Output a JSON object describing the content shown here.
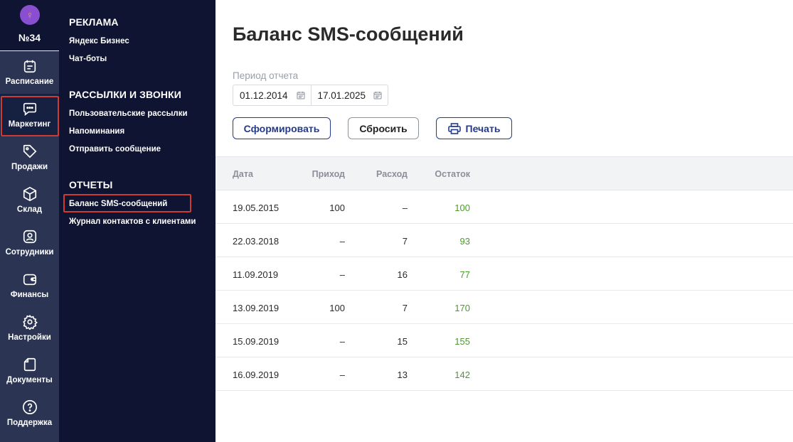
{
  "branch": {
    "number": "№34"
  },
  "rail": [
    {
      "label": "Расписание",
      "icon": "calendar-icon"
    },
    {
      "label": "Маркетинг",
      "icon": "chat-bubble-icon"
    },
    {
      "label": "Продажи",
      "icon": "tag-icon"
    },
    {
      "label": "Склад",
      "icon": "box-icon"
    },
    {
      "label": "Сотрудники",
      "icon": "user-badge-icon"
    },
    {
      "label": "Финансы",
      "icon": "wallet-icon"
    },
    {
      "label": "Настройки",
      "icon": "gear-icon"
    },
    {
      "label": "Документы",
      "icon": "document-icon"
    },
    {
      "label": "Поддержка",
      "icon": "help-icon"
    }
  ],
  "submenu": {
    "sections": [
      {
        "title": "РЕКЛАМА",
        "links": [
          "Яндекс Бизнес",
          "Чат-боты"
        ]
      },
      {
        "title": "РАССЫЛКИ И ЗВОНКИ",
        "links": [
          "Пользовательские рассылки",
          "Напоминания",
          "Отправить сообщение"
        ]
      },
      {
        "title": "ОТЧЕТЫ",
        "links": [
          "Баланс SMS-сообщений",
          "Журнал контактов с клиентами"
        ]
      }
    ]
  },
  "page": {
    "title": "Баланс SMS-сообщений",
    "period_label": "Период отчета",
    "date_from": "01.12.2014",
    "date_to": "17.01.2025",
    "btn_generate": "Сформировать",
    "btn_reset": "Сбросить",
    "btn_print": "Печать"
  },
  "table": {
    "headers": {
      "date": "Дата",
      "in": "Приход",
      "out": "Расход",
      "balance": "Остаток"
    },
    "rows": [
      {
        "date": "19.05.2015",
        "in": "100",
        "out": "–",
        "balance": "100"
      },
      {
        "date": "22.03.2018",
        "in": "–",
        "out": "7",
        "balance": "93"
      },
      {
        "date": "11.09.2019",
        "in": "–",
        "out": "16",
        "balance": "77"
      },
      {
        "date": "13.09.2019",
        "in": "100",
        "out": "7",
        "balance": "170"
      },
      {
        "date": "15.09.2019",
        "in": "–",
        "out": "15",
        "balance": "155"
      },
      {
        "date": "16.09.2019",
        "in": "–",
        "out": "13",
        "balance": "142"
      }
    ]
  },
  "colors": {
    "rail_bg": "#2b3553",
    "panel_bg": "#0e1431",
    "accent": "#243a8a",
    "highlight": "#cf3b33",
    "balance_green": "#4a9a2c"
  }
}
